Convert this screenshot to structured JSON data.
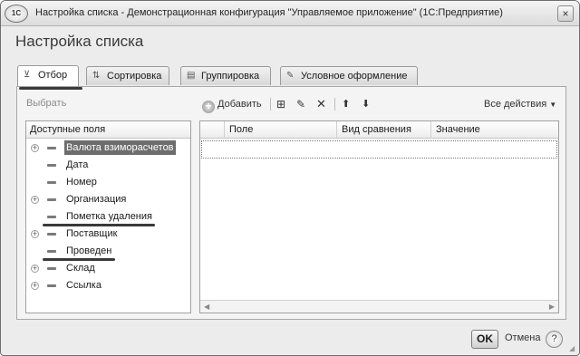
{
  "window": {
    "logo_text": "1С",
    "title": "Настройка списка - Демонстрационная конфигурация \"Управляемое приложение\" (1С:Предприятие)",
    "close_glyph": "×"
  },
  "form": {
    "title": "Настройка списка"
  },
  "tabs": [
    {
      "label": "Отбор",
      "icon": "filter-icon",
      "active": true
    },
    {
      "label": "Сортировка",
      "icon": "sort-icon",
      "active": false
    },
    {
      "label": "Группировка",
      "icon": "group-icon",
      "active": false
    },
    {
      "label": "Условное оформление",
      "icon": "conditional-format-icon",
      "active": false
    }
  ],
  "select_label": "Выбрать",
  "toolbar": {
    "add_label": "Добавить",
    "all_actions_label": "Все действия",
    "icons": [
      "add-icon",
      "add-group-icon",
      "edit-icon",
      "delete-icon",
      "move-up-icon",
      "move-down-icon"
    ]
  },
  "available_fields": {
    "header": "Доступные поля",
    "items": [
      {
        "label": "Валюта взиморасчетов",
        "expandable": true,
        "selected": true
      },
      {
        "label": "Дата",
        "expandable": false
      },
      {
        "label": "Номер",
        "expandable": false
      },
      {
        "label": "Организация",
        "expandable": true
      },
      {
        "label": "Пометка удаления",
        "expandable": false,
        "marked": true
      },
      {
        "label": "Поставщик",
        "expandable": true
      },
      {
        "label": "Проведен",
        "expandable": false,
        "marked": true
      },
      {
        "label": "Склад",
        "expandable": true
      },
      {
        "label": "Ссылка",
        "expandable": true
      }
    ]
  },
  "filter_grid": {
    "columns": [
      "Поле",
      "Вид сравнения",
      "Значение"
    ]
  },
  "footer": {
    "ok_label": "OK",
    "cancel_label": "Отмена",
    "help_label": "?"
  },
  "colors": {
    "selection": "#6d6d6d",
    "frame": "#ececec"
  }
}
